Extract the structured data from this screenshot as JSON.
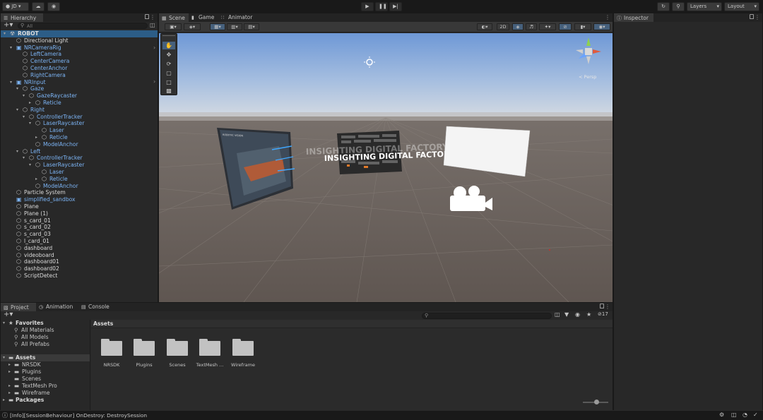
{
  "toolbar": {
    "account": "JD",
    "layers": "Layers",
    "layout": "Layout"
  },
  "hierarchy": {
    "tab": "Hierarchy",
    "search_placeholder": "All",
    "items": [
      {
        "label": "ROBOT",
        "depth": 0,
        "arrow": "open",
        "color": "white",
        "icon": "unity",
        "bold": true
      },
      {
        "label": "Directional Light",
        "depth": 1,
        "arrow": "",
        "color": "white",
        "icon": "cube"
      },
      {
        "label": "NRCameraRig",
        "depth": 1,
        "arrow": "open",
        "color": "blue",
        "icon": "prefab"
      },
      {
        "label": "LeftCamera",
        "depth": 2,
        "arrow": "",
        "color": "blue",
        "icon": "cube"
      },
      {
        "label": "CenterCamera",
        "depth": 2,
        "arrow": "",
        "color": "blue",
        "icon": "cube"
      },
      {
        "label": "CenterAnchor",
        "depth": 2,
        "arrow": "",
        "color": "blue",
        "icon": "cube"
      },
      {
        "label": "RightCamera",
        "depth": 2,
        "arrow": "",
        "color": "blue",
        "icon": "cube"
      },
      {
        "label": "NRInput",
        "depth": 1,
        "arrow": "open",
        "color": "blue",
        "icon": "prefab"
      },
      {
        "label": "Gaze",
        "depth": 2,
        "arrow": "open",
        "color": "blue",
        "icon": "cube"
      },
      {
        "label": "GazeRaycaster",
        "depth": 3,
        "arrow": "open",
        "color": "blue",
        "icon": "cube"
      },
      {
        "label": "Reticle",
        "depth": 4,
        "arrow": "closed",
        "color": "blue",
        "icon": "cube"
      },
      {
        "label": "Right",
        "depth": 2,
        "arrow": "open",
        "color": "blue",
        "icon": "cube"
      },
      {
        "label": "ControllerTracker",
        "depth": 3,
        "arrow": "open",
        "color": "blue",
        "icon": "cube"
      },
      {
        "label": "LaserRaycaster",
        "depth": 4,
        "arrow": "open",
        "color": "blue",
        "icon": "cube"
      },
      {
        "label": "Laser",
        "depth": 5,
        "arrow": "",
        "color": "blue",
        "icon": "cube"
      },
      {
        "label": "Reticle",
        "depth": 5,
        "arrow": "closed",
        "color": "blue",
        "icon": "cube"
      },
      {
        "label": "ModelAnchor",
        "depth": 4,
        "arrow": "",
        "color": "blue",
        "icon": "cube"
      },
      {
        "label": "Left",
        "depth": 2,
        "arrow": "open",
        "color": "blue",
        "icon": "cube"
      },
      {
        "label": "ControllerTracker",
        "depth": 3,
        "arrow": "open",
        "color": "blue",
        "icon": "cube"
      },
      {
        "label": "LaserRaycaster",
        "depth": 4,
        "arrow": "open",
        "color": "blue",
        "icon": "cube"
      },
      {
        "label": "Laser",
        "depth": 5,
        "arrow": "",
        "color": "blue",
        "icon": "cube"
      },
      {
        "label": "Reticle",
        "depth": 5,
        "arrow": "closed",
        "color": "blue",
        "icon": "cube"
      },
      {
        "label": "ModelAnchor",
        "depth": 4,
        "arrow": "",
        "color": "blue",
        "icon": "cube"
      },
      {
        "label": "Particle System",
        "depth": 1,
        "arrow": "",
        "color": "white",
        "icon": "cube"
      },
      {
        "label": "simplified_sandbox",
        "depth": 1,
        "arrow": "",
        "color": "blue",
        "icon": "prefab"
      },
      {
        "label": "Plane",
        "depth": 1,
        "arrow": "",
        "color": "white",
        "icon": "cube"
      },
      {
        "label": "Plane (1)",
        "depth": 1,
        "arrow": "",
        "color": "white",
        "icon": "cube"
      },
      {
        "label": "s_card_01",
        "depth": 1,
        "arrow": "",
        "color": "white",
        "icon": "cube"
      },
      {
        "label": "s_card_02",
        "depth": 1,
        "arrow": "",
        "color": "white",
        "icon": "cube"
      },
      {
        "label": "s_card_03",
        "depth": 1,
        "arrow": "",
        "color": "white",
        "icon": "cube"
      },
      {
        "label": "l_card_01",
        "depth": 1,
        "arrow": "",
        "color": "white",
        "icon": "cube"
      },
      {
        "label": "dashboard",
        "depth": 1,
        "arrow": "",
        "color": "white",
        "icon": "cube"
      },
      {
        "label": "videoboard",
        "depth": 1,
        "arrow": "",
        "color": "white",
        "icon": "cube"
      },
      {
        "label": "dashboard01",
        "depth": 1,
        "arrow": "",
        "color": "white",
        "icon": "cube"
      },
      {
        "label": "dashboard02",
        "depth": 1,
        "arrow": "",
        "color": "white",
        "icon": "cube"
      },
      {
        "label": "ScriptDetect",
        "depth": 1,
        "arrow": "",
        "color": "white",
        "icon": "cube"
      }
    ]
  },
  "scene": {
    "tabs": [
      "Scene",
      "Game",
      "Animator"
    ],
    "toggle_2d": "2D",
    "banner_text": "INSIGHTING DIGITAL FACTORY",
    "banner_ghost": "INSIGHTING DIGITAL FACTORY",
    "card_title": "ROBOTIC VISION",
    "gizmo_label": "< Persp"
  },
  "inspector": {
    "tab": "Inspector"
  },
  "project": {
    "tabs": [
      "Project",
      "Animation",
      "Console"
    ],
    "hidden_count": "17",
    "favorites_label": "Favorites",
    "favorites": [
      "All Materials",
      "All Models",
      "All Prefabs"
    ],
    "assets_label": "Assets",
    "asset_tree": [
      "NRSDK",
      "Plugins",
      "Scenes",
      "TextMesh Pro",
      "Wireframe"
    ],
    "packages_label": "Packages",
    "breadcrumb": "Assets",
    "folders": [
      "NRSDK",
      "Plugins",
      "Scenes",
      "TextMesh ...",
      "Wireframe"
    ],
    "zoom_level": 0.55
  },
  "status": {
    "message": "[Info][SessionBehaviour] OnDestroy: DestroySession"
  },
  "colors": {
    "selection": "#2c5d87",
    "prefab_text": "#7cb4f5",
    "sky_top": "#6e98d6",
    "ground": "#5f5651"
  }
}
